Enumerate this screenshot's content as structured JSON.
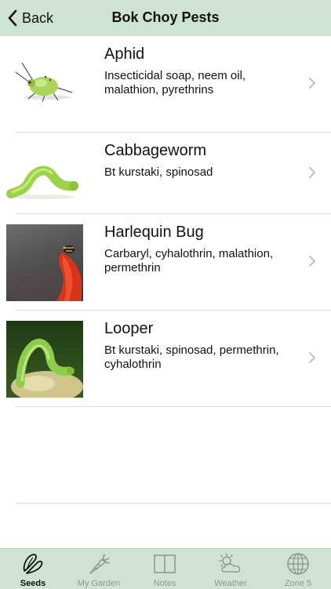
{
  "nav": {
    "back_label": "Back",
    "title": "Bok Choy Pests"
  },
  "pests": [
    {
      "name": "Aphid",
      "treatments": "Insecticidal soap, neem oil, malathion, pyrethrins",
      "image": "aphid-photo"
    },
    {
      "name": "Cabbageworm",
      "treatments": "Bt kurstaki, spinosad",
      "image": "cabbageworm-photo"
    },
    {
      "name": "Harlequin Bug",
      "treatments": "Carbaryl, cyhalothrin, malathion, permethrin",
      "image": "harlequin-bug-photo"
    },
    {
      "name": "Looper",
      "treatments": "Bt kurstaki, spinosad, permethrin, cyhalothrin",
      "image": "looper-photo"
    }
  ],
  "tabs": [
    {
      "label": "Seeds",
      "icon": "seeds-icon",
      "active": true
    },
    {
      "label": "My Garden",
      "icon": "carrot-icon",
      "active": false
    },
    {
      "label": "Notes",
      "icon": "book-icon",
      "active": false
    },
    {
      "label": "Weather",
      "icon": "sun-cloud-icon",
      "active": false
    },
    {
      "label": "Zone 5",
      "icon": "globe-icon",
      "active": false
    }
  ],
  "colors": {
    "bar_background": "#cfe3d3",
    "tab_inactive": "#8e9a90",
    "tab_active": "#111111"
  }
}
